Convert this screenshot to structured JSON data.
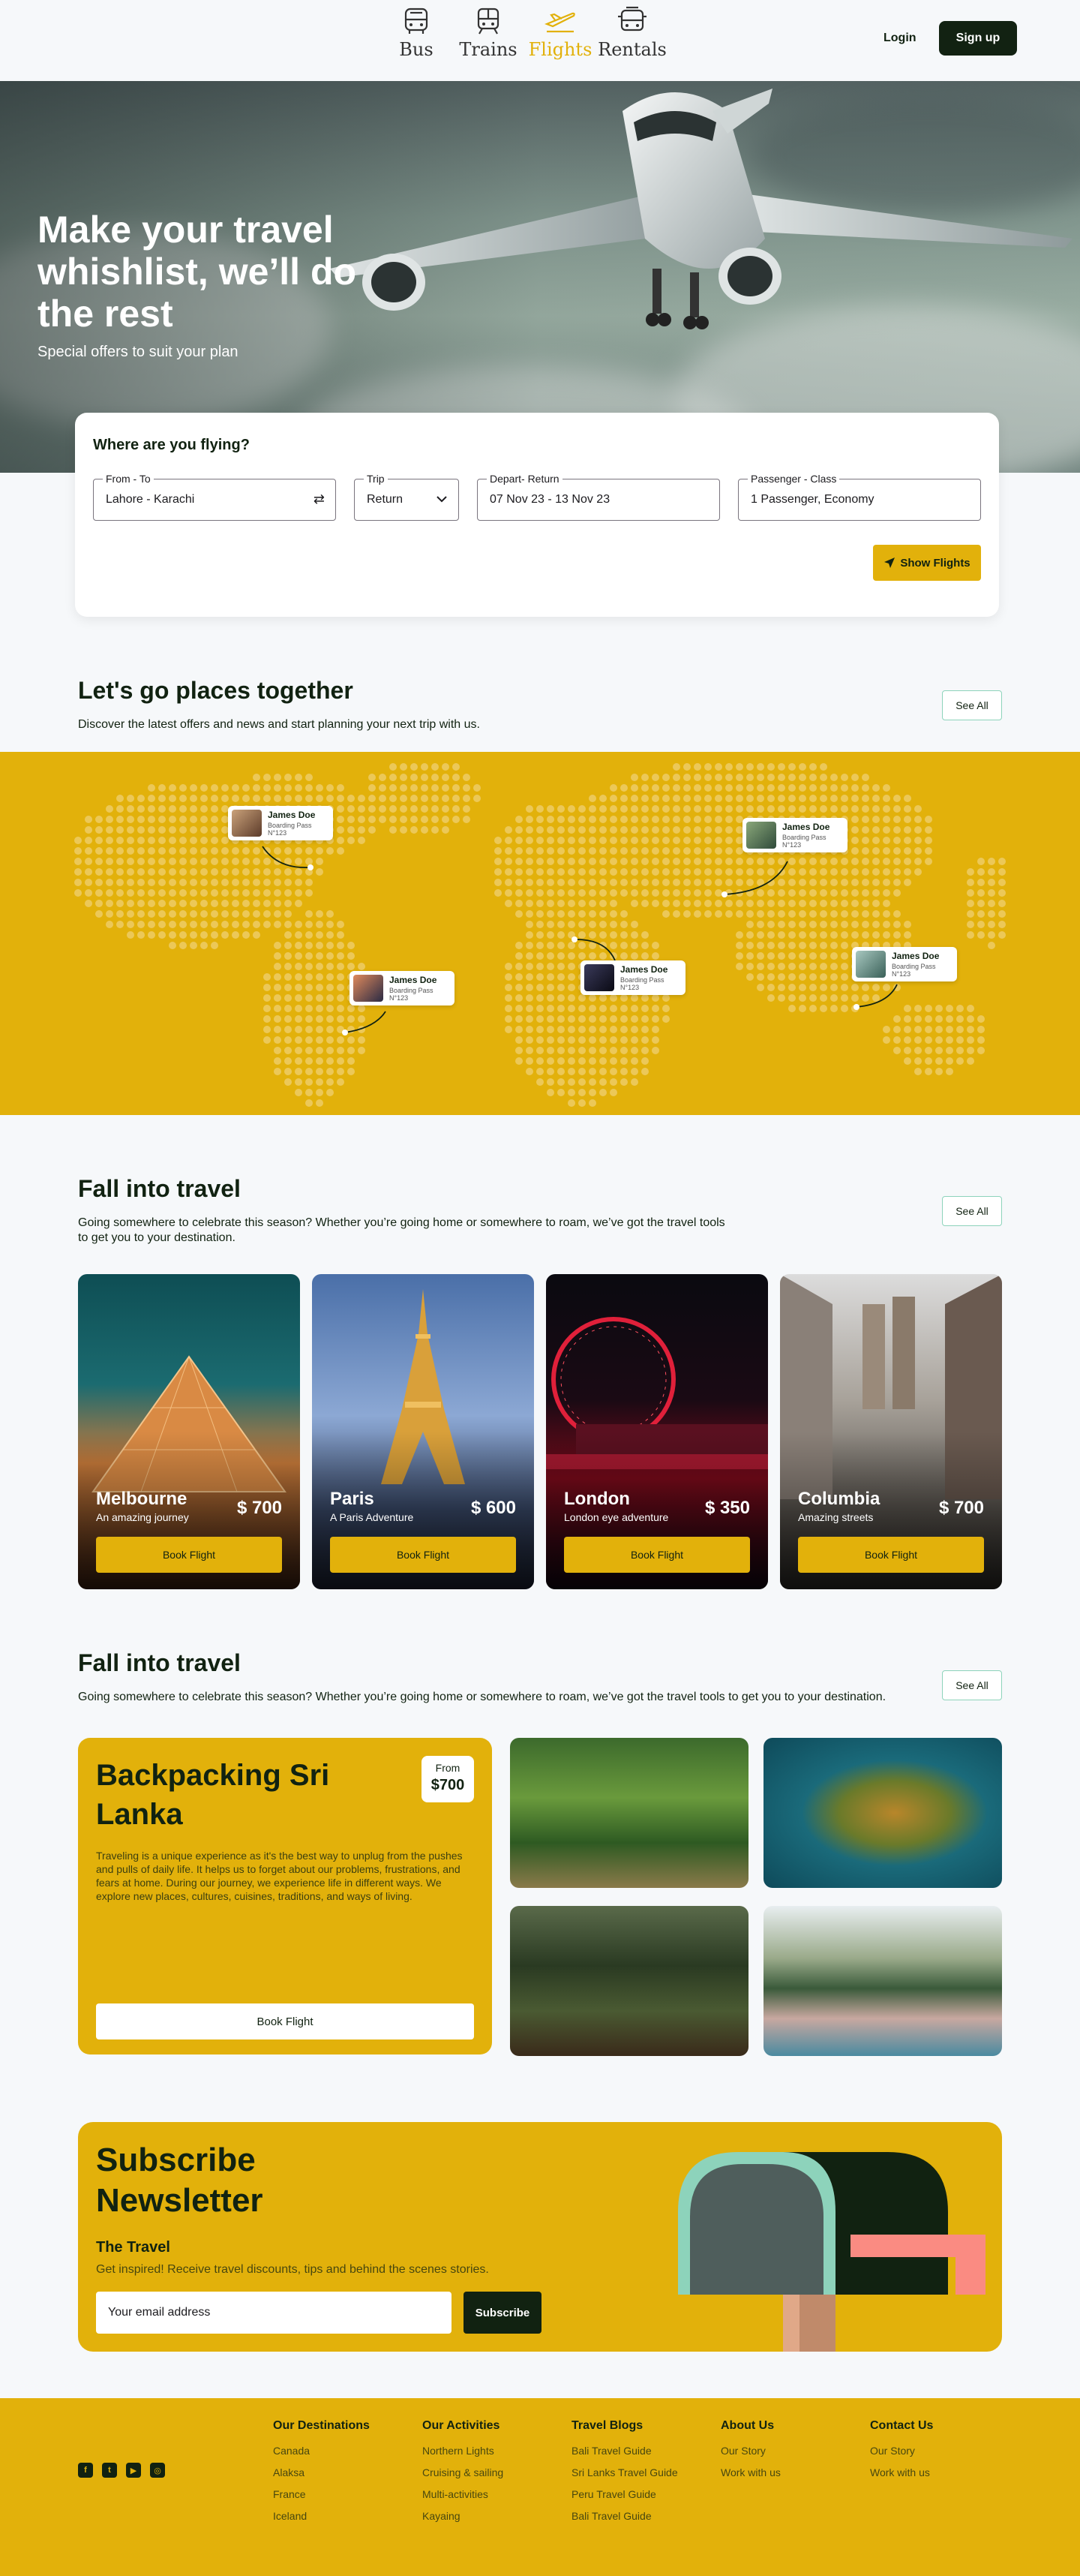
{
  "nav": {
    "items": [
      {
        "label": "Bus",
        "icon": "bus-icon"
      },
      {
        "label": "Trains",
        "icon": "train-icon"
      },
      {
        "label": "Flights",
        "icon": "plane-icon"
      },
      {
        "label": "Rentals",
        "icon": "rental-car-icon"
      }
    ],
    "active": "Flights",
    "login": "Login",
    "signup": "Sign up"
  },
  "hero": {
    "title": "Make your travel whishlist, we’ll do the rest",
    "subtitle": "Special offers to suit your plan"
  },
  "search": {
    "question": "Where are you flying?",
    "fields": [
      {
        "label": "From - To",
        "value": "Lahore - Karachi",
        "icon": "swap-icon"
      },
      {
        "label": "Trip",
        "value": "Return",
        "icon": "chevron-down-icon"
      },
      {
        "label": "Depart- Return",
        "value": "07 Nov 23 - 13 Nov 23"
      },
      {
        "label": "Passenger - Class",
        "value": "1 Passenger, Economy"
      }
    ],
    "button": "Show Flights"
  },
  "places": {
    "title": "Let's go places together",
    "desc": "Discover the latest offers and news and start planning your next trip with us.",
    "see_all": "See All",
    "pins": [
      {
        "name": "James Doe",
        "pass": "Boarding Pass N°123"
      },
      {
        "name": "James Doe",
        "pass": "Boarding Pass N°123"
      },
      {
        "name": "James Doe",
        "pass": "Boarding Pass N°123"
      },
      {
        "name": "James Doe",
        "pass": "Boarding Pass N°123"
      },
      {
        "name": "James Doe",
        "pass": "Boarding Pass N°123"
      }
    ]
  },
  "fall1": {
    "title": "Fall into travel",
    "desc": "Going somewhere to celebrate this season? Whether you’re going home or somewhere to roam, we’ve got the travel tools to get you to your destination.",
    "see_all": "See All",
    "cards": [
      {
        "name": "Melbourne",
        "tag": "An amazing journey",
        "price": "$ 700",
        "button": "Book Flight"
      },
      {
        "name": "Paris",
        "tag": "A Paris Adventure",
        "price": "$ 600",
        "button": "Book Flight"
      },
      {
        "name": "London",
        "tag": "London eye adventure",
        "price": "$ 350",
        "button": "Book Flight"
      },
      {
        "name": "Columbia",
        "tag": "Amazing streets",
        "price": "$ 700",
        "button": "Book Flight"
      }
    ]
  },
  "fall2": {
    "title": "Fall into travel",
    "desc": "Going somewhere to celebrate this season? Whether you’re going home or somewhere to roam, we’ve got the travel tools to get you to your destination.",
    "see_all": "See All",
    "feature": {
      "title": "Backpacking Sri Lanka",
      "from_label": "From",
      "from_price": "$700",
      "text": "Traveling is a unique experience as it's the best way to unplug from the pushes and pulls of daily life. It helps us to forget about our problems, frustrations, and fears at home. During our journey, we experience life in different ways. We explore new places, cultures, cuisines, traditions, and ways of living.",
      "button": "Book Flight"
    }
  },
  "newsletter": {
    "title": "Subscribe Newsletter",
    "subtitle": "The Travel",
    "desc": "Get inspired! Receive travel discounts, tips and behind the scenes stories.",
    "placeholder": "Your email address",
    "button": "Subscribe"
  },
  "footer": {
    "socials": [
      "facebook-icon",
      "twitter-icon",
      "youtube-icon",
      "instagram-icon"
    ],
    "columns": [
      {
        "title": "Our Destinations",
        "links": [
          "Canada",
          "Alaksa",
          "France",
          "Iceland"
        ]
      },
      {
        "title": "Our Activities",
        "links": [
          "Northern Lights",
          "Cruising & sailing",
          "Multi-activities",
          "Kayaing"
        ]
      },
      {
        "title": "Travel Blogs",
        "links": [
          "Bali Travel Guide",
          "Sri Lanks Travel Guide",
          "Peru Travel Guide",
          "Bali Travel Guide"
        ]
      },
      {
        "title": "About Us",
        "links": [
          "Our Story",
          "Work with us"
        ]
      },
      {
        "title": "Contact Us",
        "links": [
          "Our Story",
          "Work with us"
        ]
      }
    ]
  },
  "colors": {
    "accent": "#E2B10B",
    "dark": "#112211",
    "mint": "#8DD3BB",
    "bg": "#F6F8FA"
  }
}
